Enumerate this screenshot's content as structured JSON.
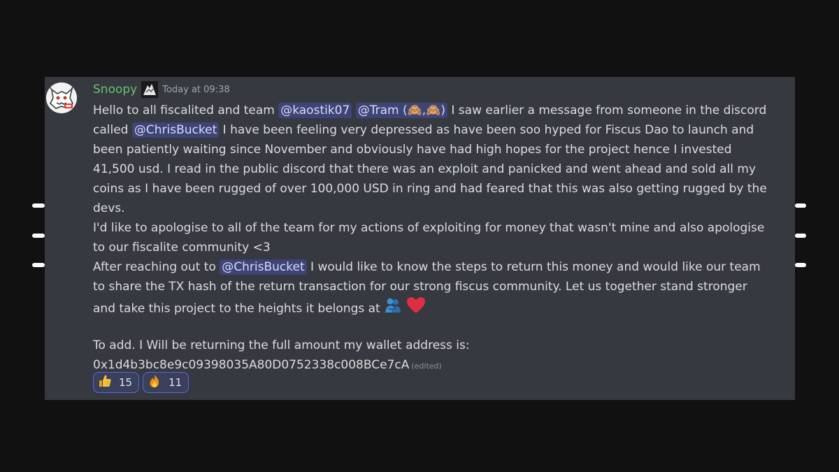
{
  "message": {
    "username": "Snoopy",
    "timestamp": "Today at 09:38",
    "lines": {
      "l1": {
        "t1": "Hello to all fiscalited and team ",
        "m1": "@kaostik07",
        "m2": "@Tram (🙈,🙈)",
        "t2": " I saw earlier a message from someone in the discord"
      },
      "l2": {
        "t1": "called ",
        "m1": "@ChrisBucket",
        "t2": " I have been feeling very depressed as have been soo hyped for Fiscus Dao to launch and"
      },
      "l3": "been patiently waiting since November and obviously have had high hopes for the project hence I invested",
      "l4": "41,500 usd. I read in the public discord that there was an exploit and panicked and went ahead and sold all my",
      "l5": "coins as I have been rugged of over 100,000 USD in ring and had feared that this was also getting rugged by the",
      "l6": "devs.",
      "l7": "I'd like to apologise to all of the team for my actions of exploiting for money that wasn't mine and also apologise",
      "l8": "to our fiscalite community <3",
      "l9": {
        "t1": "After reaching out to ",
        "m1": "@ChrisBucket",
        "t2": " I would like to know the steps to return this money and would like our team"
      },
      "l10": "to share the TX hash of the return transaction for our strong fiscus community. Let us together stand stronger",
      "l11": "and take this project to the heights it belongs at ",
      "l12": "To add. I Will be returning the full amount my wallet address is:",
      "l13": "0x1d4b3bc8e9c09398035A80D0752338c008BCe7cA",
      "edited": "(edited)"
    },
    "inline_emojis": [
      "people-hugging-emoji",
      "red-heart-emoji"
    ]
  },
  "reactions": [
    {
      "emoji": "thumbs-up-emoji",
      "count": "15"
    },
    {
      "emoji": "fire-emoji",
      "count": "11"
    }
  ],
  "colors": {
    "background": "#111111",
    "card": "#36393f",
    "username": "#67c36a",
    "text": "#dcddde",
    "mention_bg": "#3e4476",
    "reaction_border": "#5865f2"
  }
}
